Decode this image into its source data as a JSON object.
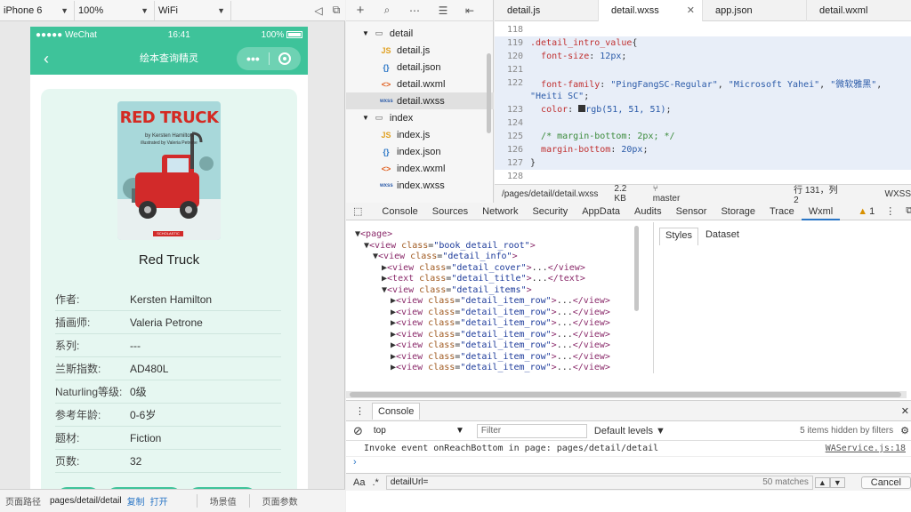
{
  "simulator": {
    "device": "iPhone 6",
    "zoom": "100%",
    "network": "WiFi",
    "status": {
      "carrier": "●●●●● WeChat",
      "time": "16:41",
      "battery": "100%"
    },
    "nav_title": "绘本查询精灵",
    "book": {
      "title": "Red Truck",
      "cover_title": "RED TRUCK",
      "cover_author_line": "by Kersten Hamilton",
      "cover_illustrator_line": "illustrated by Valeria Petrone",
      "cover_publisher": "SCHOLASTIC",
      "rows": [
        {
          "key": "作者:",
          "value": "Kersten Hamilton"
        },
        {
          "key": "插画师:",
          "value": "Valeria Petrone"
        },
        {
          "key": "系列:",
          "value": "---"
        },
        {
          "key": "兰斯指数:",
          "value": "AD480L"
        },
        {
          "key": "Naturling等级:",
          "value": "0级"
        },
        {
          "key": "参考年龄:",
          "value": "0-6岁"
        },
        {
          "key": "题材:",
          "value": "Fiction"
        },
        {
          "key": "页数:",
          "value": "32"
        }
      ]
    },
    "bottom": {
      "path_label": "页面路径",
      "path": "pages/detail/detail",
      "copy": "复制",
      "open": "打开",
      "scene": "场景值",
      "params": "页面参数"
    }
  },
  "filetree": {
    "items": [
      {
        "label": "detail",
        "type": "folder"
      },
      {
        "label": "detail.js",
        "type": "js"
      },
      {
        "label": "detail.json",
        "type": "json"
      },
      {
        "label": "detail.wxml",
        "type": "wxml"
      },
      {
        "label": "detail.wxss",
        "type": "wxss"
      },
      {
        "label": "index",
        "type": "folder"
      },
      {
        "label": "index.js",
        "type": "js"
      },
      {
        "label": "index.json",
        "type": "json"
      },
      {
        "label": "index.wxml",
        "type": "wxml"
      },
      {
        "label": "index.wxss",
        "type": "wxss"
      }
    ]
  },
  "editor": {
    "tabs": [
      "detail.js",
      "detail.wxss",
      "app.json",
      "detail.wxml"
    ],
    "status": {
      "path": "/pages/detail/detail.wxss",
      "size": "2.2 KB",
      "branch": "master",
      "pos": "行 131，列 2",
      "lang": "WXSS"
    }
  },
  "devtools": {
    "tabs": [
      "Console",
      "Sources",
      "Network",
      "Security",
      "AppData",
      "Audits",
      "Sensor",
      "Storage",
      "Trace",
      "Wxml"
    ],
    "warn_count": "1",
    "styles_tabs": [
      "Styles",
      "Dataset"
    ],
    "console": {
      "title": "Console",
      "context": "top",
      "filter_placeholder": "Filter",
      "levels": "Default levels",
      "hidden": "5 items hidden by filters",
      "message": "Invoke event onReachBottom in page: pages/detail/detail",
      "source": "WAService.js:18"
    },
    "search": {
      "aa": "Aa",
      "regex": ".*",
      "query": "detailUrl=",
      "matches": "50 matches",
      "cancel": "Cancel"
    }
  },
  "colors": {
    "accent": "#3ec39a",
    "card": "#e6f7f1"
  }
}
